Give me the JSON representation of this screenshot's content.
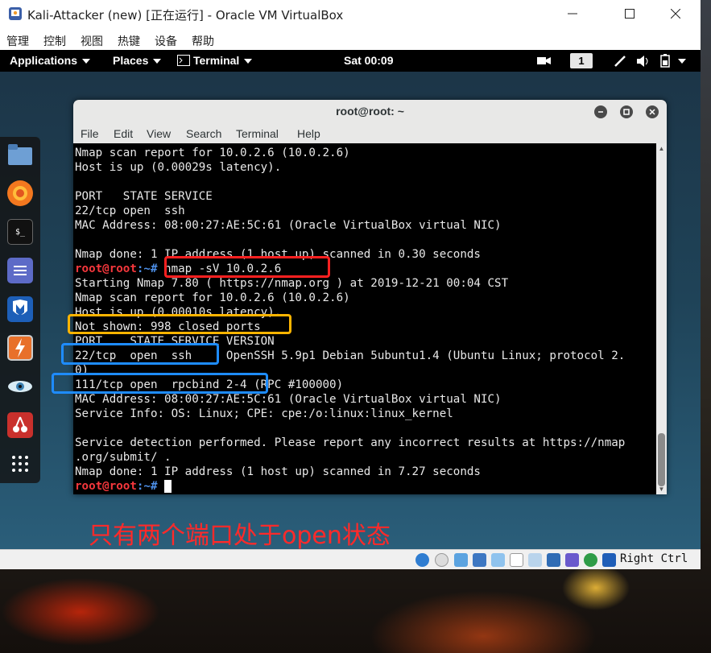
{
  "window": {
    "title": "Kali-Attacker (new) [正在运行] - Oracle VM VirtualBox",
    "menu": [
      "管理",
      "控制",
      "视图",
      "热键",
      "设备",
      "帮助"
    ]
  },
  "gnome_bar": {
    "applications": "Applications",
    "places": "Places",
    "terminal": "Terminal",
    "clock": "Sat 00:09",
    "workspace": "1"
  },
  "dock": {
    "icons": [
      "files-icon",
      "firefox-icon",
      "terminal-icon",
      "notes-icon",
      "metasploit-icon",
      "burpsuite-icon",
      "eye-icon",
      "cherrytree-icon",
      "app-grid-icon"
    ]
  },
  "terminal": {
    "title": "root@root: ~",
    "menu": [
      "File",
      "Edit",
      "View",
      "Search",
      "Terminal",
      "Help"
    ],
    "prompt_user": "root@root",
    "prompt_path": ":~#",
    "lines": [
      "Nmap scan report for 10.0.2.6 (10.0.2.6)",
      "Host is up (0.00029s latency).",
      "",
      "PORT   STATE SERVICE",
      "22/tcp open  ssh",
      "MAC Address: 08:00:27:AE:5C:61 (Oracle VirtualBox virtual NIC)",
      "",
      "Nmap done: 1 IP address (1 host up) scanned in 0.30 seconds",
      " nmap -sV 10.0.2.6",
      "Starting Nmap 7.80 ( https://nmap.org ) at 2019-12-21 00:04 CST",
      "Nmap scan report for 10.0.2.6 (10.0.2.6)",
      "Host is up (0.00010s latency).",
      "Not shown: 998 closed ports",
      "PORT    STATE SERVICE VERSION",
      "22/tcp  open  ssh     OpenSSH 5.9p1 Debian 5ubuntu1.4 (Ubuntu Linux; protocol 2.",
      "0)",
      "111/tcp open  rpcbind 2-4 (RPC #100000)",
      "MAC Address: 08:00:27:AE:5C:61 (Oracle VirtualBox virtual NIC)",
      "Service Info: OS: Linux; CPE: cpe:/o:linux:linux_kernel",
      "",
      "Service detection performed. Please report any incorrect results at https://nmap",
      ".org/submit/ .",
      "Nmap done: 1 IP address (1 host up) scanned in 7.27 seconds",
      " "
    ]
  },
  "annotation": {
    "caption": "只有两个端口处于open状态",
    "colors": {
      "red": "#ff2020",
      "orange": "#ffb400",
      "blue": "#1e8cff"
    }
  },
  "statusbar": {
    "host_key": "Right Ctrl"
  }
}
